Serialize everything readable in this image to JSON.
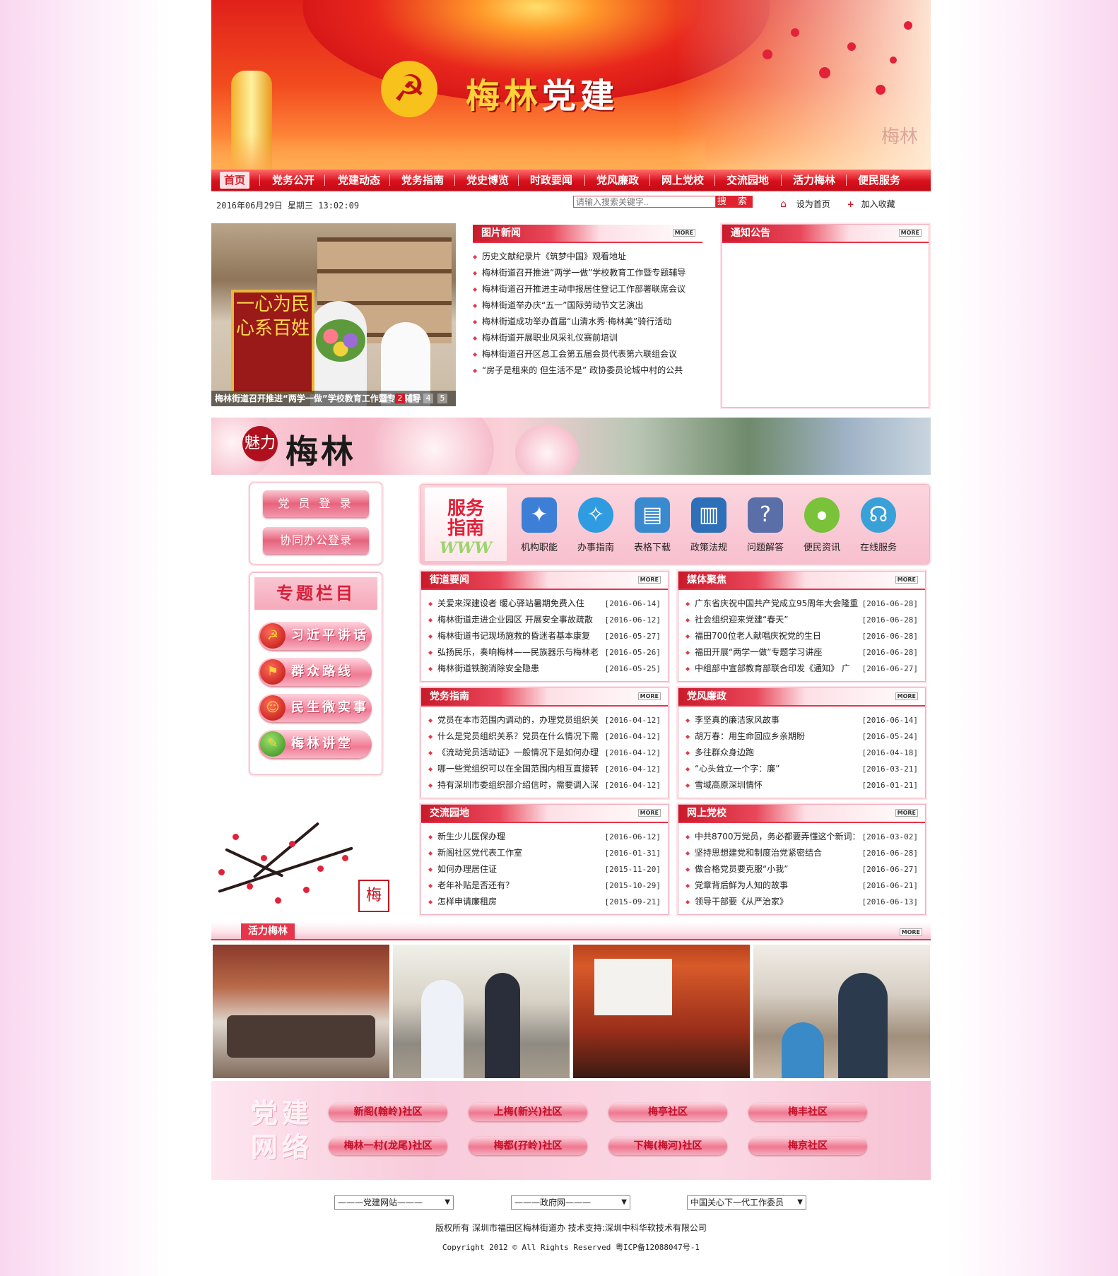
{
  "colors": {
    "brand_red": "#d21b27",
    "pink_light": "#fde4ea",
    "pink_border": "#f3b4c1"
  },
  "banner": {
    "title_a": "梅林",
    "title_b": "党建",
    "watermark": "梅林",
    "emblem_icon": "hammer-sickle-icon"
  },
  "nav": {
    "items": [
      "首页",
      "党务公开",
      "党建动态",
      "党务指南",
      "党史博览",
      "时政要闻",
      "党风廉政",
      "网上党校",
      "交流园地",
      "活力梅林",
      "便民服务"
    ],
    "active": "首页"
  },
  "infobar": {
    "date": "2016年06月29日 星期三 13:02:09",
    "search_placeholder": "请输入搜索关键字..",
    "search_button": "搜 索",
    "set_home": "设为首页",
    "add_favorite": "加入收藏"
  },
  "hero": {
    "caption": "梅林街道召开推进“两学一做”学校教育工作暨专题辅导",
    "pages": [
      "1",
      "2",
      "3",
      "4",
      "5"
    ],
    "active_page": "2",
    "flag_text": "一心为民 心系百姓"
  },
  "picture_news": {
    "title": "图片新闻",
    "more": "MORE",
    "items": [
      "历史文献纪录片《筑梦中国》观看地址",
      "梅林街道召开推进“两学一做”学校教育工作暨专题辅导",
      "梅林街道召开推进主动申报居住登记工作部署联席会议",
      "梅林街道举办庆“五一”国际劳动节文艺演出",
      "梅林街道成功举办首届“山清水秀·梅林美”骑行活动",
      "梅林街道开展职业风采礼仪赛前培训",
      "梅林街道召开区总工会第五届会员代表第六联组会议",
      "“房子是租来的 但生活不是” 政协委员论城中村的公共"
    ]
  },
  "notice": {
    "title": "通知公告",
    "more": "MORE"
  },
  "charm": {
    "ring": "魅力",
    "word": "梅林"
  },
  "login": {
    "member_login": "党 员 登 录",
    "office_login": "协同办公登录"
  },
  "topics": {
    "title": "专题栏目",
    "items": [
      "习近平讲话",
      "群众路线",
      "民生微实事",
      "梅林讲堂"
    ]
  },
  "service": {
    "logo_a": "服务",
    "logo_b": "指南",
    "logo_www": "WWW",
    "items": [
      {
        "label": "机构职能",
        "icon": "puzzle-icon",
        "color": "#3d7fd6"
      },
      {
        "label": "办事指南",
        "icon": "compass-icon",
        "color": "#2f9be0"
      },
      {
        "label": "表格下载",
        "icon": "form-download-icon",
        "color": "#3a8ad0"
      },
      {
        "label": "政策法规",
        "icon": "binders-icon",
        "color": "#2d6fb8"
      },
      {
        "label": "问题解答",
        "icon": "question-icon",
        "color": "#5a6fa8"
      },
      {
        "label": "便民资讯",
        "icon": "live-apple-icon",
        "color": "#79c23a"
      },
      {
        "label": "在线服务",
        "icon": "headset-icon",
        "color": "#3aa0d8"
      }
    ]
  },
  "sections": [
    {
      "title": "街道要闻",
      "more": "MORE",
      "items": [
        {
          "t": "关爱来深建设者 暖心驿站暑期免费入住",
          "d": "[2016-06-14]"
        },
        {
          "t": "梅林街道走进企业园区 开展安全事故疏散",
          "d": "[2016-06-12]"
        },
        {
          "t": "梅林街道书记现场施救的昏迷者基本康复",
          "d": "[2016-05-27]"
        },
        {
          "t": "弘扬民乐，奏响梅林——民族器乐与梅林老",
          "d": "[2016-05-26]"
        },
        {
          "t": "梅林街道铁腕消除安全隐患",
          "d": "[2016-05-25]"
        }
      ]
    },
    {
      "title": "媒体聚焦",
      "more": "MORE",
      "items": [
        {
          "t": "广东省庆祝中国共产党成立95周年大会隆重",
          "d": "[2016-06-28]"
        },
        {
          "t": "社会组织迎来党建“春天”",
          "d": "[2016-06-28]"
        },
        {
          "t": "福田700位老人献唱庆祝党的生日",
          "d": "[2016-06-28]"
        },
        {
          "t": "福田开展“两学一做”专题学习讲座",
          "d": "[2016-06-28]"
        },
        {
          "t": "中组部中宣部教育部联合印发《通知》 广",
          "d": "[2016-06-27]"
        }
      ]
    },
    {
      "title": "党务指南",
      "more": "MORE",
      "items": [
        {
          "t": "党员在本市范围内调动的，办理党员组织关",
          "d": "[2016-04-12]"
        },
        {
          "t": "什么是党员组织关系？党员在什么情况下需",
          "d": "[2016-04-12]"
        },
        {
          "t": "《流动党员活动证》一般情况下是如何办理",
          "d": "[2016-04-12]"
        },
        {
          "t": "哪一些党组织可以在全国范围内相互直接转",
          "d": "[2016-04-12]"
        },
        {
          "t": "持有深圳市委组织部介绍信时，需要调入深",
          "d": "[2016-04-12]"
        }
      ]
    },
    {
      "title": "党风廉政",
      "more": "MORE",
      "items": [
        {
          "t": "李坚真的廉洁家风故事",
          "d": "[2016-06-14]"
        },
        {
          "t": "胡万春：用生命回应乡亲期盼",
          "d": "[2016-05-24]"
        },
        {
          "t": "多往群众身边跑",
          "d": "[2016-04-18]"
        },
        {
          "t": "“心头耸立一个字：廉”",
          "d": "[2016-03-21]"
        },
        {
          "t": "雪域高原深圳情怀",
          "d": "[2016-01-21]"
        }
      ]
    },
    {
      "title": "交流园地",
      "more": "MORE",
      "items": [
        {
          "t": "新生少儿医保办理",
          "d": "[2016-06-12]"
        },
        {
          "t": "新阁社区党代表工作室",
          "d": "[2016-01-31]"
        },
        {
          "t": "如何办理居住证",
          "d": "[2015-11-20]"
        },
        {
          "t": "老年补贴是否还有？",
          "d": "[2015-10-29]"
        },
        {
          "t": "怎样申请廉租房",
          "d": "[2015-09-21]"
        }
      ]
    },
    {
      "title": "网上党校",
      "more": "MORE",
      "items": [
        {
          "t": "中共8700万党员，务必都要弄懂这个新词：",
          "d": "[2016-03-02]"
        },
        {
          "t": "坚持思想建党和制度治党紧密结合",
          "d": "[2016-06-28]"
        },
        {
          "t": "做合格党员要克服“小我”",
          "d": "[2016-06-27]"
        },
        {
          "t": "党章背后鲜为人知的故事",
          "d": "[2016-06-21]"
        },
        {
          "t": "领导干部要《从严治家》",
          "d": "[2016-06-13]"
        }
      ]
    }
  ],
  "vitality": {
    "title": "活力梅林",
    "more": "MORE"
  },
  "network": {
    "big_a": "党建",
    "big_b": "网络",
    "links": [
      "新阁(翰岭)社区",
      "上梅(新兴)社区",
      "梅亭社区",
      "梅丰社区",
      "梅林一村(龙尾)社区",
      "梅都(孖岭)社区",
      "下梅(梅河)社区",
      "梅京社区"
    ]
  },
  "footer": {
    "selects": [
      "———党建网站———",
      "———政府网———",
      "中国关心下一代工作委员"
    ],
    "line1": "版权所有  深圳市福田区梅林街道办  技术支持:深圳中科华软技术有限公司",
    "line2": "Copyright 2012 © All Rights Reserved   粤ICP备12088047号-1",
    "seal_char": "梅"
  }
}
